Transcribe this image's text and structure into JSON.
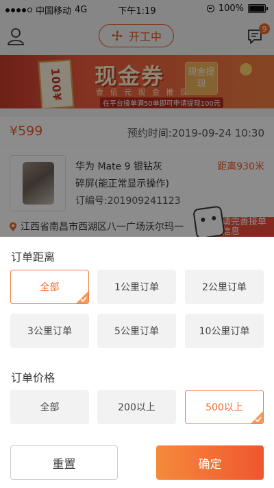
{
  "status_bar": {
    "carrier": "中国移动",
    "network": "4G",
    "time": "下午1:19",
    "battery": "100%"
  },
  "header": {
    "work_status": "开工中",
    "message_count": "9"
  },
  "banner": {
    "ticket_text": "100¥",
    "title": "现金券",
    "subtitle": "壹 佰 元 现 金 推 现",
    "note": "在平台接单满50单即可申请提现100元",
    "cash_out": "现金提现"
  },
  "order": {
    "price": "¥599",
    "appointment": "预约时间:2019-09-24 10:30",
    "product": "华为 Mate 9 银钻灰",
    "issue": "碎屏(能正常显示操作)",
    "order_no": "订编号:201909241123",
    "distance": "距离930米",
    "address": "江西省南昌市西湖区八一广场沃尔玛一",
    "complete_ad": "请完善接单信息"
  },
  "filters": {
    "distance": {
      "title": "订单距离",
      "options": [
        "全部",
        "1公里订单",
        "2公里订单",
        "3公里订单",
        "5公里订单",
        "10公里订单"
      ],
      "selected": "全部"
    },
    "price": {
      "title": "订单价格",
      "options": [
        "全部",
        "200以上",
        "500以上"
      ],
      "selected": "500以上"
    }
  },
  "actions": {
    "reset": "重置",
    "confirm": "确定"
  },
  "colors": {
    "accent": "#ef6a28",
    "selected_border": "#f07b3f",
    "chip_bg": "#f2f2f2"
  },
  "icons": {
    "user": "user-icon",
    "work": "fan-icon",
    "message": "message-icon",
    "location": "location-pin-icon",
    "check": "check-icon"
  }
}
